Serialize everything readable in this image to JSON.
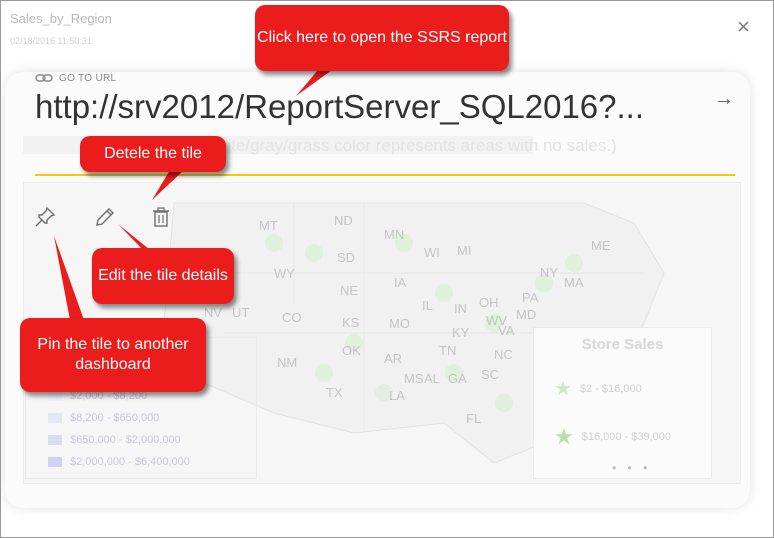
{
  "background": {
    "title": "Sales_by_Region",
    "subtitle": "02/18/2016 11:50:31",
    "close_icon": "close-icon"
  },
  "panel": {
    "go_to_url_label": "GO TO URL",
    "url": "http://srv2012/ReportServer_SQL2016?...",
    "report_subtitle": "(white/gray/grass color represents areas with no sales.)",
    "accent_color": "#f2c811"
  },
  "map": {
    "states": [
      "MT",
      "ND",
      "SD",
      "MN",
      "WI",
      "MI",
      "NE",
      "IA",
      "IL",
      "IN",
      "OH",
      "PA",
      "NY",
      "ME",
      "MA",
      "WY",
      "UT",
      "CO",
      "KS",
      "MO",
      "KY",
      "WV",
      "MD",
      "VA",
      "OK",
      "AR",
      "TN",
      "NC",
      "SC",
      "NM",
      "TX",
      "LA",
      "MS",
      "AL",
      "GA",
      "FL",
      "NV"
    ]
  },
  "legend_left": {
    "items": [
      "$2,000 - $8,200",
      "$8,200 - $650,000",
      "$650,000 - $2,000,000",
      "$2,000,000 - $6,400,000"
    ]
  },
  "store_sales": {
    "title": "Store Sales",
    "items": [
      "$2 - $16,000",
      "$16,000 - $39,000"
    ],
    "more": "• • •"
  },
  "tools": {
    "pin_icon": "pin-icon",
    "edit_icon": "pencil-icon",
    "delete_icon": "trash-icon"
  },
  "callouts": {
    "open_report": "Click here to open the SSRS report",
    "delete_tile": "Detele the tile",
    "edit_tile": "Edit the tile details",
    "pin_tile": "Pin the tile to another dashboard"
  },
  "colors": {
    "callout": "#ea1c1c",
    "store_star": "#9bd68f"
  }
}
